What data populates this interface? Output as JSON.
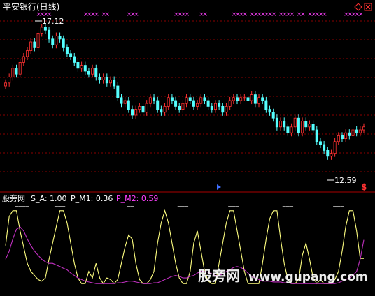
{
  "window": {
    "title": "平安银行(日线)"
  },
  "icons": {
    "diamond": "diamond-icon",
    "close": "close-icon",
    "dollar": "dollar-icon",
    "arrow": "right-arrow-icon"
  },
  "price_panel": {
    "high_label": "17.12",
    "low_label": "12.59",
    "grid_color": "#8b0000",
    "up_color": "#ff3232",
    "down_color": "#54ffff",
    "signal_color": "#ff40ff"
  },
  "indicator_panel": {
    "source": "股旁网",
    "label_s_a": "S_A: 1.00",
    "label_p_m1": "P_M1: 0.36",
    "label_p_m2": "P_M2: 0.59",
    "p_m1_color": "#ffff80",
    "p_m2_color": "#c030c0"
  },
  "watermark": {
    "chinese": "股旁网",
    "url": "www.gupang.com"
  },
  "chart_data": {
    "type": "candlestick",
    "title": "平安银行(日线)",
    "price": {
      "ylim": [
        11.5,
        17.5
      ],
      "highest": 17.12,
      "lowest": 12.59,
      "close": [
        15.1,
        15.3,
        15.6,
        15.4,
        15.8,
        16.0,
        16.2,
        16.5,
        16.3,
        16.8,
        17.0,
        16.9,
        16.6,
        16.4,
        16.7,
        16.6,
        16.3,
        16.1,
        16.0,
        15.8,
        15.6,
        15.7,
        15.5,
        15.4,
        15.6,
        15.3,
        15.2,
        15.3,
        15.1,
        15.2,
        15.0,
        14.6,
        14.4,
        14.5,
        14.2,
        14.0,
        14.2,
        14.3,
        14.1,
        14.4,
        14.6,
        14.5,
        14.2,
        14.1,
        14.3,
        14.6,
        14.5,
        14.3,
        14.2,
        14.4,
        14.6,
        14.5,
        14.3,
        14.4,
        14.6,
        14.5,
        14.3,
        14.2,
        14.4,
        14.3,
        14.1,
        14.3,
        14.5,
        14.6,
        14.5,
        14.6,
        14.6,
        14.5,
        14.7,
        14.4,
        14.6,
        14.5,
        14.2,
        14.1,
        13.9,
        13.6,
        13.8,
        13.6,
        13.4,
        13.6,
        13.9,
        13.4,
        13.8,
        13.6,
        13.7,
        13.5,
        13.1,
        13.0,
        12.8,
        12.6,
        12.7,
        13.1,
        13.3,
        13.2,
        13.4,
        13.3,
        13.5,
        13.4,
        13.5,
        13.6
      ],
      "open": [
        15.0,
        15.1,
        15.3,
        15.6,
        15.4,
        15.8,
        16.0,
        16.2,
        16.5,
        16.3,
        16.8,
        17.0,
        16.9,
        16.6,
        16.4,
        16.7,
        16.6,
        16.3,
        16.1,
        16.0,
        15.8,
        15.6,
        15.7,
        15.5,
        15.4,
        15.6,
        15.3,
        15.2,
        15.3,
        15.1,
        15.2,
        15.0,
        14.6,
        14.4,
        14.5,
        14.2,
        14.0,
        14.2,
        14.3,
        14.1,
        14.4,
        14.6,
        14.5,
        14.2,
        14.1,
        14.3,
        14.6,
        14.5,
        14.3,
        14.2,
        14.4,
        14.6,
        14.5,
        14.3,
        14.4,
        14.6,
        14.5,
        14.3,
        14.2,
        14.4,
        14.3,
        14.1,
        14.3,
        14.5,
        14.6,
        14.5,
        14.6,
        14.6,
        14.5,
        14.7,
        14.4,
        14.6,
        14.5,
        14.2,
        14.1,
        13.9,
        13.6,
        13.8,
        13.6,
        13.4,
        13.6,
        13.9,
        13.4,
        13.8,
        13.6,
        13.7,
        13.5,
        13.1,
        13.0,
        12.8,
        12.6,
        12.7,
        13.1,
        13.3,
        13.2,
        13.4,
        13.3,
        13.5,
        13.4,
        13.5
      ],
      "signal_days": [
        9,
        10,
        11,
        12,
        22,
        23,
        24,
        25,
        27,
        28,
        34,
        35,
        36,
        47,
        48,
        49,
        50,
        54,
        55,
        63,
        64,
        65,
        66,
        68,
        69,
        70,
        71,
        72,
        73,
        74,
        76,
        77,
        78,
        79,
        81,
        82,
        84,
        85,
        86,
        87,
        88,
        94,
        95,
        96,
        97,
        98
      ]
    },
    "indicator": {
      "ylim": [
        0,
        1
      ],
      "series": [
        {
          "name": "P_M1",
          "values": [
            0.52,
            0.88,
            0.95,
            0.95,
            0.7,
            0.5,
            0.3,
            0.2,
            0.15,
            0.1,
            0.08,
            0.12,
            0.35,
            0.55,
            0.75,
            0.95,
            0.95,
            0.8,
            0.55,
            0.3,
            0.12,
            0.05,
            0.05,
            0.2,
            0.12,
            0.3,
            0.12,
            0.05,
            0.12,
            0.1,
            0.05,
            0.1,
            0.3,
            0.5,
            0.65,
            0.6,
            0.3,
            0.1,
            0.05,
            0.05,
            0.1,
            0.2,
            0.55,
            0.8,
            0.95,
            0.8,
            0.55,
            0.3,
            0.12,
            0.05,
            0.05,
            0.2,
            0.55,
            0.7,
            0.45,
            0.2,
            0.08,
            0.05,
            0.05,
            0.3,
            0.55,
            0.8,
            0.95,
            0.95,
            0.7,
            0.45,
            0.2,
            0.05,
            0.05,
            0.05,
            0.05,
            0.3,
            0.6,
            0.85,
            0.95,
            0.95,
            0.6,
            0.3,
            0.1,
            0.05,
            0.05,
            0.1,
            0.4,
            0.55,
            0.35,
            0.12,
            0.05,
            0.1,
            0.05,
            0.05,
            0.05,
            0.1,
            0.2,
            0.45,
            0.75,
            0.95,
            0.95,
            0.7,
            0.36,
            0.36
          ]
        },
        {
          "name": "P_M2",
          "values": [
            0.35,
            0.45,
            0.6,
            0.72,
            0.75,
            0.7,
            0.6,
            0.52,
            0.45,
            0.4,
            0.35,
            0.32,
            0.3,
            0.3,
            0.28,
            0.26,
            0.24,
            0.22,
            0.18,
            0.15,
            0.12,
            0.1,
            0.08,
            0.07,
            0.06,
            0.05,
            0.05,
            0.05,
            0.05,
            0.05,
            0.05,
            0.06,
            0.06,
            0.07,
            0.08,
            0.08,
            0.07,
            0.06,
            0.05,
            0.05,
            0.05,
            0.06,
            0.06,
            0.08,
            0.1,
            0.12,
            0.14,
            0.15,
            0.14,
            0.12,
            0.12,
            0.14,
            0.15,
            0.18,
            0.2,
            0.2,
            0.19,
            0.17,
            0.15,
            0.15,
            0.17,
            0.2,
            0.22,
            0.25,
            0.26,
            0.25,
            0.22,
            0.18,
            0.14,
            0.12,
            0.1,
            0.08,
            0.08,
            0.08,
            0.07,
            0.07,
            0.07,
            0.06,
            0.06,
            0.05,
            0.05,
            0.05,
            0.05,
            0.05,
            0.05,
            0.05,
            0.05,
            0.05,
            0.05,
            0.05,
            0.05,
            0.05,
            0.06,
            0.08,
            0.1,
            0.12,
            0.15,
            0.2,
            0.35,
            0.59
          ]
        }
      ],
      "s_a_marks": [
        3,
        4,
        5,
        6,
        14,
        15,
        16,
        34,
        35,
        48,
        49,
        50,
        62,
        63,
        64,
        77,
        78,
        79,
        91,
        92,
        93
      ]
    }
  }
}
